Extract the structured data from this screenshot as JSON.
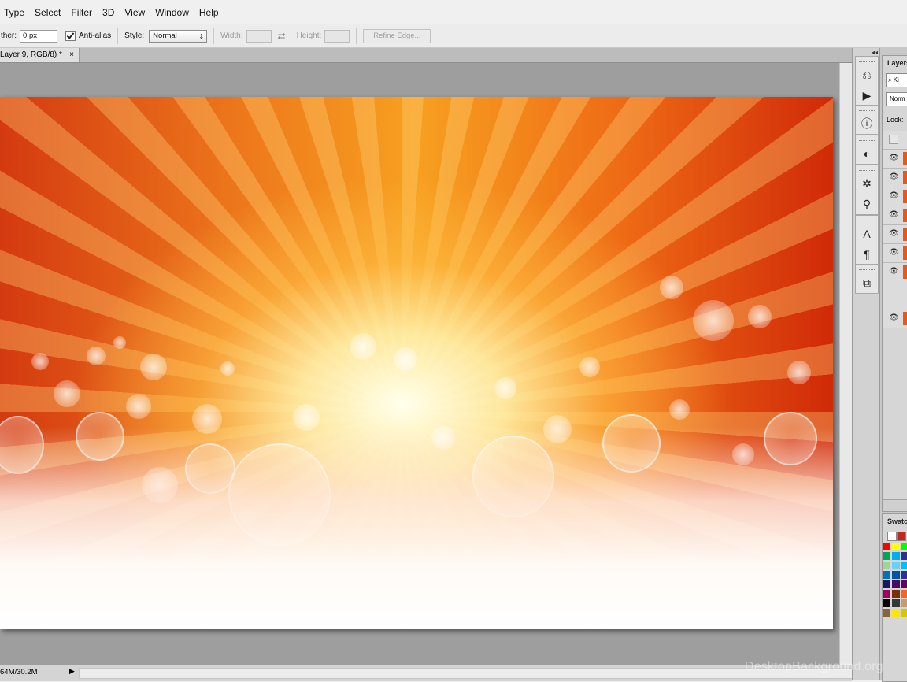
{
  "menubar": {
    "items": [
      "Type",
      "Select",
      "Filter",
      "3D",
      "View",
      "Window",
      "Help"
    ]
  },
  "options": {
    "feather_label": "ther:",
    "feather_value": "0 px",
    "antialias_label": "Anti-alias",
    "antialias_checked": true,
    "style_label": "Style:",
    "style_value": "Normal",
    "width_label": "Width:",
    "width_value": "",
    "height_label": "Height:",
    "height_value": "",
    "refine_edge_label": "Refine Edge..."
  },
  "document": {
    "tab_title": "Layer 9, RGB/8) *",
    "tab_close": "×"
  },
  "statusbar": {
    "doc_size": "64M/30.2M"
  },
  "dock": {
    "collapse_glyph": "◂◂",
    "icons": [
      "history-icon",
      "actions-play-icon",
      "info-icon",
      "adjustments-icon",
      "brush-presets-icon",
      "clone-source-icon",
      "character-icon",
      "paragraph-icon",
      "3d-icon"
    ]
  },
  "layers_panel": {
    "tab_label": "Layers",
    "search_text": "Ki",
    "blend_mode": "Norm",
    "lock_label": "Lock:",
    "visible_rows": 9
  },
  "swatches_panel": {
    "tab_label": "Swatc",
    "foreground": "#ffffff",
    "background": "#c0281e",
    "colors": [
      [
        "#ff0000",
        "#ffff00",
        "#00ff00"
      ],
      [
        "#00a651",
        "#00aeef",
        "#2e3192"
      ],
      [
        "#a3d39c",
        "#6dcff6",
        "#00bff3"
      ],
      [
        "#0072bc",
        "#0054a6",
        "#2e3192"
      ],
      [
        "#1b1464",
        "#440e62",
        "#630460"
      ],
      [
        "#9e005d",
        "#7b2e00",
        "#f26522"
      ],
      [
        "#000000",
        "#363636",
        "#c69c6d"
      ],
      [
        "#8c6239",
        "#ffe600",
        "#d7c700"
      ]
    ]
  },
  "watermark": "DesktopBackground.org"
}
